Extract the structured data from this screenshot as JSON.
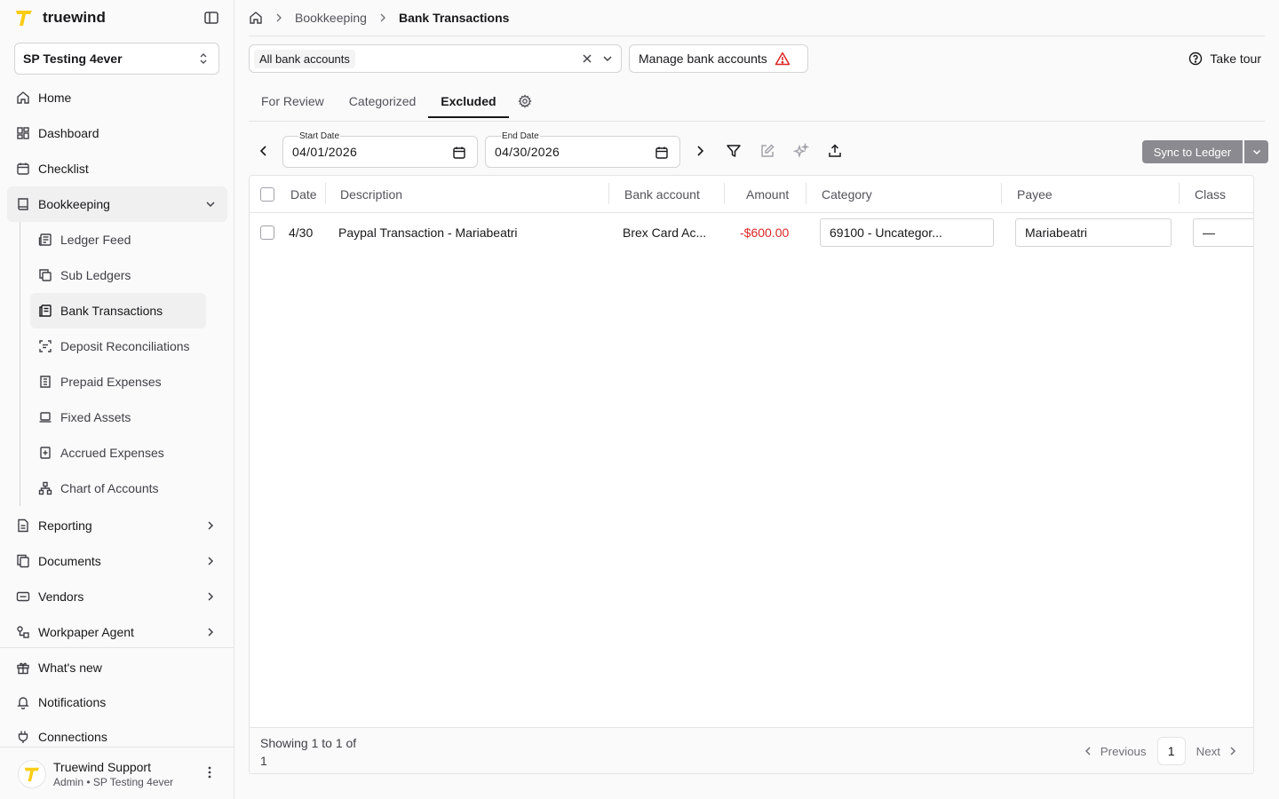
{
  "brand": {
    "name": "truewind",
    "accent": "#facc15"
  },
  "org": {
    "selected": "SP Testing 4ever"
  },
  "nav": {
    "home": "Home",
    "dashboard": "Dashboard",
    "checklist": "Checklist",
    "bookkeeping": "Bookkeeping",
    "bookkeeping_items": [
      "Ledger Feed",
      "Sub Ledgers",
      "Bank Transactions",
      "Deposit Reconciliations",
      "Prepaid Expenses",
      "Fixed Assets",
      "Accrued Expenses",
      "Chart of Accounts"
    ],
    "reporting": "Reporting",
    "documents": "Documents",
    "vendors": "Vendors",
    "workpaper_agent": "Workpaper Agent",
    "whats_new": "What's new",
    "notifications": "Notifications",
    "connections": "Connections"
  },
  "user": {
    "name": "Truewind Support",
    "role": "Admin • SP Testing 4ever"
  },
  "breadcrumb": {
    "parent": "Bookkeeping",
    "current": "Bank Transactions"
  },
  "accounts_filter": {
    "selected": "All bank accounts"
  },
  "manage_accounts_label": "Manage bank accounts",
  "take_tour_label": "Take tour",
  "tabs": [
    "For Review",
    "Categorized",
    "Excluded"
  ],
  "active_tab": "Excluded",
  "dates": {
    "start_label": "Start Date",
    "start_value": "04/01/2026",
    "end_label": "End Date",
    "end_value": "04/30/2026"
  },
  "sync_label": "Sync to Ledger",
  "table": {
    "columns": [
      "Date",
      "Description",
      "Bank account",
      "Amount",
      "Category",
      "Payee",
      "Class"
    ],
    "rows": [
      {
        "date": "4/30",
        "description": "Paypal Transaction - Mariabeatri",
        "bank_account": "Brex Card Ac...",
        "amount": "-$600.00",
        "category": "69100 - Uncategor...",
        "payee": "Mariabeatri",
        "class": "—"
      }
    ]
  },
  "footer": {
    "showing": "Showing 1 to 1 of 1",
    "previous": "Previous",
    "page": "1",
    "next": "Next"
  },
  "colors": {
    "negative_amount": "#dc2626",
    "warning_icon": "#dc2626"
  }
}
